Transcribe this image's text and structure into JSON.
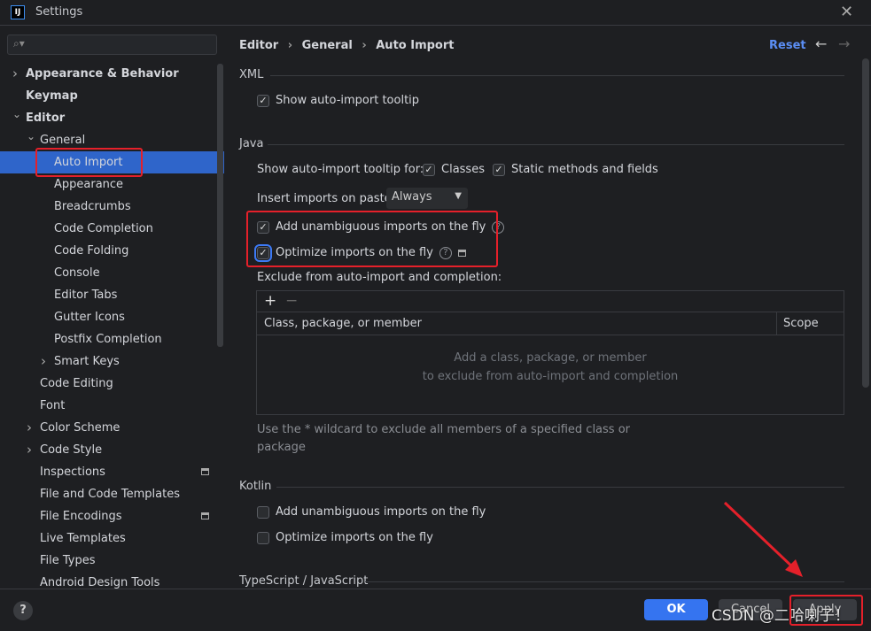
{
  "window": {
    "title": "Settings",
    "logo": "IJ"
  },
  "search": {
    "placeholder": ""
  },
  "sidebar": {
    "items": [
      {
        "label": "Appearance & Behavior",
        "level": 0,
        "bold": true,
        "expander": "collapsed"
      },
      {
        "label": "Keymap",
        "level": 0,
        "bold": true,
        "expander": "none"
      },
      {
        "label": "Editor",
        "level": 0,
        "bold": true,
        "expander": "expanded"
      },
      {
        "label": "General",
        "level": 1,
        "expander": "expanded"
      },
      {
        "label": "Auto Import",
        "level": 2,
        "selected": true
      },
      {
        "label": "Appearance",
        "level": 2
      },
      {
        "label": "Breadcrumbs",
        "level": 2
      },
      {
        "label": "Code Completion",
        "level": 2
      },
      {
        "label": "Code Folding",
        "level": 2
      },
      {
        "label": "Console",
        "level": 2
      },
      {
        "label": "Editor Tabs",
        "level": 2
      },
      {
        "label": "Gutter Icons",
        "level": 2
      },
      {
        "label": "Postfix Completion",
        "level": 2
      },
      {
        "label": "Smart Keys",
        "level": 2,
        "expander": "collapsed"
      },
      {
        "label": "Code Editing",
        "level": 1
      },
      {
        "label": "Font",
        "level": 1
      },
      {
        "label": "Color Scheme",
        "level": 1,
        "expander": "collapsed"
      },
      {
        "label": "Code Style",
        "level": 1,
        "expander": "collapsed"
      },
      {
        "label": "Inspections",
        "level": 1,
        "badge": true
      },
      {
        "label": "File and Code Templates",
        "level": 1
      },
      {
        "label": "File Encodings",
        "level": 1,
        "badge": true
      },
      {
        "label": "Live Templates",
        "level": 1
      },
      {
        "label": "File Types",
        "level": 1
      },
      {
        "label": "Android Design Tools",
        "level": 1
      }
    ]
  },
  "header": {
    "breadcrumb": [
      "Editor",
      "General",
      "Auto Import"
    ],
    "separator": "›",
    "reset": "Reset"
  },
  "xml": {
    "title": "XML",
    "show_tooltip": {
      "label": "Show auto-import tooltip",
      "checked": true
    }
  },
  "java": {
    "title": "Java",
    "tooltip_for": "Show auto-import tooltip for:",
    "classes": {
      "label": "Classes",
      "checked": true
    },
    "static": {
      "label": "Static methods and fields",
      "checked": true
    },
    "paste_label": "Insert imports on paste:",
    "paste_value": "Always",
    "unambiguous": {
      "label": "Add unambiguous imports on the fly",
      "checked": true
    },
    "optimize": {
      "label": "Optimize imports on the fly",
      "checked": true
    },
    "exclude_label": "Exclude from auto-import and completion:",
    "table": {
      "col1": "Class, package, or member",
      "col2": "Scope",
      "empty1": "Add a class, package, or member",
      "empty2": "to exclude from auto-import and completion",
      "add": "+",
      "remove": "−"
    },
    "hint1": "Use the * wildcard to exclude all members of a specified class or",
    "hint2": "package"
  },
  "kotlin": {
    "title": "Kotlin",
    "unambiguous": {
      "label": "Add unambiguous imports on the fly",
      "checked": false
    },
    "optimize": {
      "label": "Optimize imports on the fly",
      "checked": false
    }
  },
  "ts": {
    "title": "TypeScript / JavaScript"
  },
  "footer": {
    "ok": "OK",
    "cancel": "Cancel",
    "apply": "Apply",
    "help": "?"
  },
  "watermark": "CSDN @二哈喇子！",
  "colors": {
    "accent": "#3574f0",
    "highlight": "#e5202a",
    "selection": "#2f65ca"
  }
}
